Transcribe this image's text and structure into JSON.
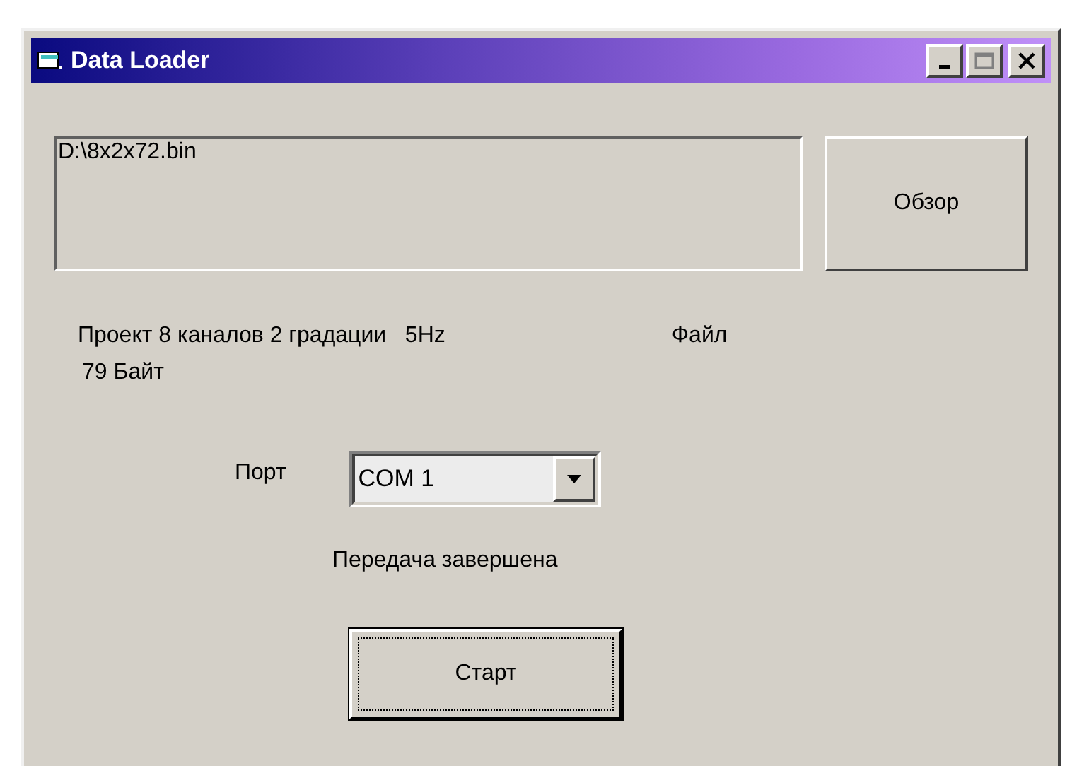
{
  "window": {
    "title": "Data Loader"
  },
  "file_field": {
    "value": "D:\\8x2x72.bin"
  },
  "browse_button": {
    "label": "Обзор"
  },
  "project_info": {
    "description": "Проект 8 каналов 2 градации   5Hz",
    "size": "79 Байт",
    "file_label": "Файл"
  },
  "port": {
    "label": "Порт",
    "value": "COM 1"
  },
  "status": "Передача завершена",
  "start_button": {
    "label": "Старт",
    "focused": true
  }
}
